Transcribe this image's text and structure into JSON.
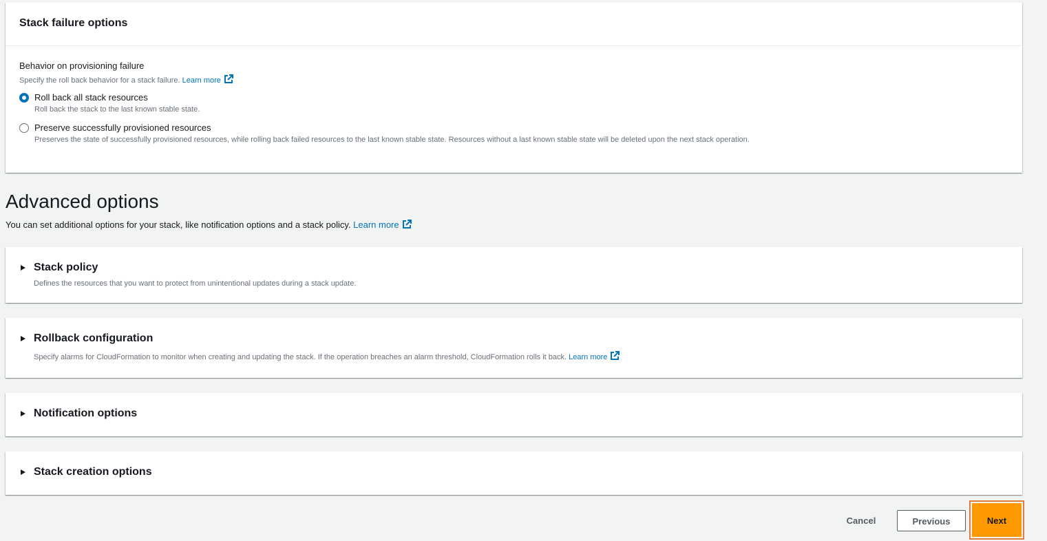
{
  "failure_panel": {
    "title": "Stack failure options",
    "field_label": "Behavior on provisioning failure",
    "field_desc": "Specify the roll back behavior for a stack failure.",
    "learn_more": "Learn more",
    "options": [
      {
        "label": "Roll back all stack resources",
        "desc": "Roll back the stack to the last known stable state.",
        "checked": true
      },
      {
        "label": "Preserve successfully provisioned resources",
        "desc": "Preserves the state of successfully provisioned resources, while rolling back failed resources to the last known stable state. Resources without a last known stable state will be deleted upon the next stack operation.",
        "checked": false
      }
    ]
  },
  "advanced": {
    "title": "Advanced options",
    "desc": "You can set additional options for your stack, like notification options and a stack policy.",
    "learn_more": "Learn more"
  },
  "sections": {
    "stack_policy": {
      "title": "Stack policy",
      "desc": "Defines the resources that you want to protect from unintentional updates during a stack update."
    },
    "rollback": {
      "title": "Rollback configuration",
      "desc": "Specify alarms for CloudFormation to monitor when creating and updating the stack. If the operation breaches an alarm threshold, CloudFormation rolls it back.",
      "learn_more": "Learn more"
    },
    "notification": {
      "title": "Notification options"
    },
    "creation": {
      "title": "Stack creation options"
    }
  },
  "footer": {
    "cancel": "Cancel",
    "previous": "Previous",
    "next": "Next"
  },
  "colors": {
    "primary_button": "#ff9900",
    "link": "#0073bb",
    "highlight": "#e07b39"
  }
}
